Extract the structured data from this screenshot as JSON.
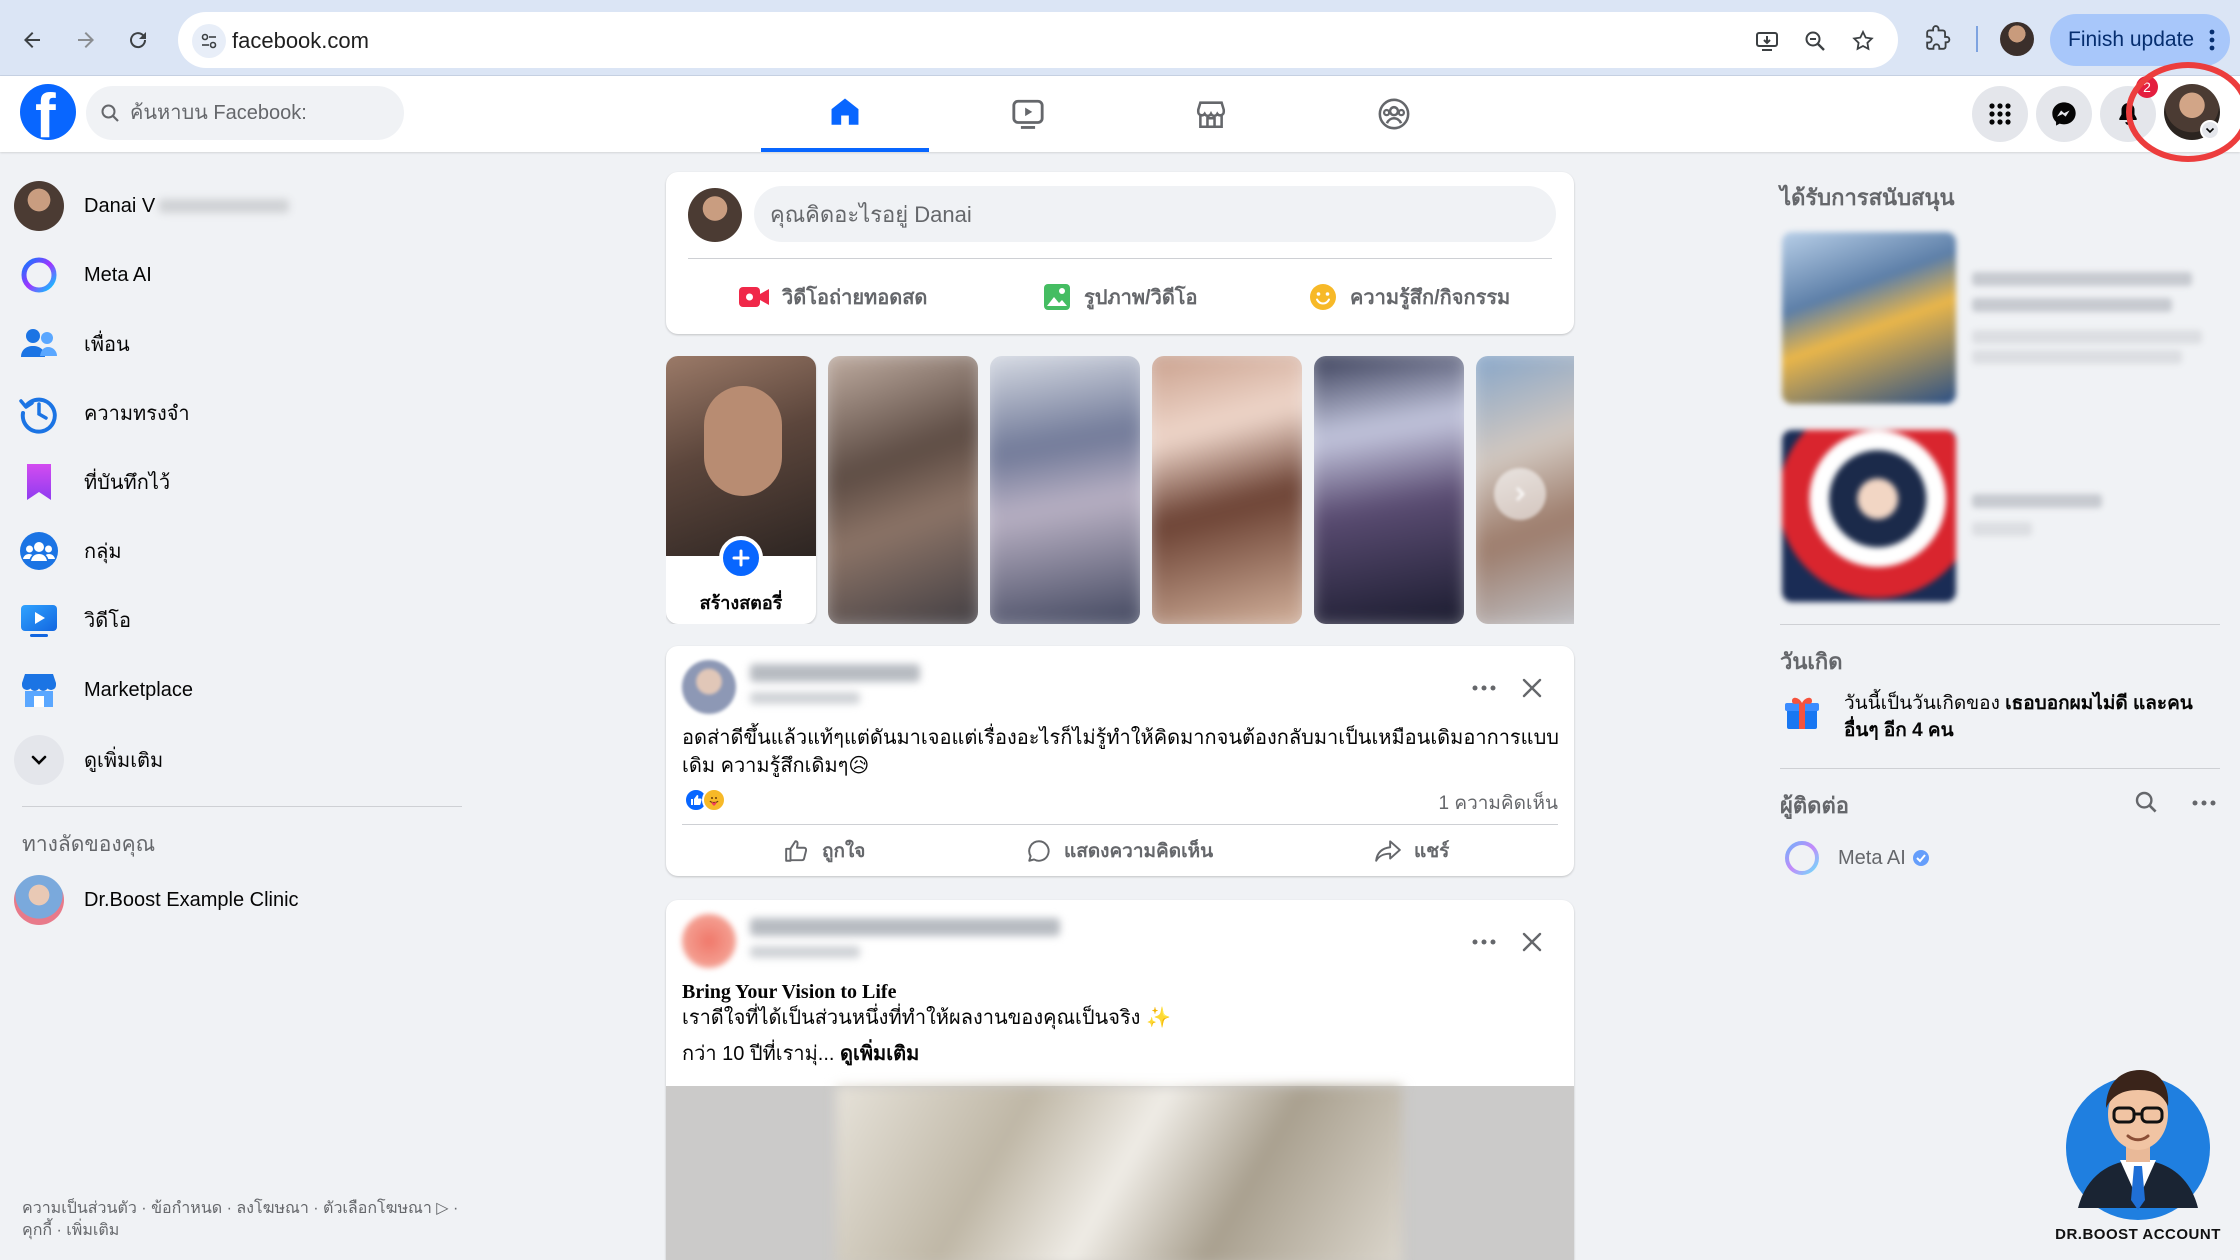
{
  "browser": {
    "url": "facebook.com",
    "update_button": "Finish update"
  },
  "header": {
    "logo": "f",
    "search_placeholder": "ค้นหาบน Facebook:",
    "notification_count": "2"
  },
  "sidebar": {
    "profile_name": "Danai V",
    "items": [
      {
        "label": "Meta AI",
        "icon": "meta-ai-icon"
      },
      {
        "label": "เพื่อน",
        "icon": "friends-icon"
      },
      {
        "label": "ความทรงจำ",
        "icon": "memories-icon"
      },
      {
        "label": "ที่บันทึกไว้",
        "icon": "saved-icon"
      },
      {
        "label": "กลุ่ม",
        "icon": "groups-icon"
      },
      {
        "label": "วิดีโอ",
        "icon": "video-icon"
      },
      {
        "label": "Marketplace",
        "icon": "marketplace-icon"
      },
      {
        "label": "ดูเพิ่มเติม",
        "icon": "chevron-down-icon"
      }
    ],
    "shortcuts_title": "ทางลัดของคุณ",
    "shortcut": "Dr.Boost Example Clinic",
    "footer": "ความเป็นส่วนตัว · ข้อกำหนด · ลงโฆษณา · ตัวเลือกโฆษณา ▷ · คุกกี้ · เพิ่มเติม"
  },
  "composer": {
    "placeholder": "คุณคิดอะไรอยู่ Danai",
    "live_video": "วิดีโอถ่ายทอดสด",
    "photo_video": "รูปภาพ/วิดีโอ",
    "feeling": "ความรู้สึก/กิจกรรม"
  },
  "stories": {
    "create_label": "สร้างสตอรี่"
  },
  "post1": {
    "text": "อดส่าดีขึ้นแล้วแท้ๆแต่ดันมาเจอแต่เรื่องอะไรก็ไม่รู้ทำให้คิดมากจนต้องกลับมาเป็นเหมือนเดิมอาการแบบเดิม ความรู้สึกเดิมๆ😥",
    "comments": "1 ความคิดเห็น",
    "like": "ถูกใจ",
    "comment": "แสดงความคิดเห็น",
    "share": "แชร์"
  },
  "post2": {
    "headline": "Bring Your Vision to Life",
    "line2": "เราดีใจที่ได้เป็นส่วนหนึ่งที่ทำให้ผลงานของคุณเป็นจริง ✨",
    "line3": "กว่า 10 ปีที่เรามุ่...",
    "see_more": "ดูเพิ่มเติม"
  },
  "right": {
    "sponsored_title": "ได้รับการสนับสนุน",
    "birthdays_title": "วันเกิด",
    "birthday_text_a": "วันนี้เป็นวันเกิดของ ",
    "birthday_bold": "เธอบอกผมไม่ดี และคนอื่นๆ อีก 4 คน",
    "contacts_title": "ผู้ติดต่อ",
    "meta_ai": "Meta AI"
  },
  "watermark": {
    "label": "DR.BOOST ACCOUNT"
  },
  "colors": {
    "brand": "#0866ff",
    "highlight": "#ec3d3d"
  }
}
